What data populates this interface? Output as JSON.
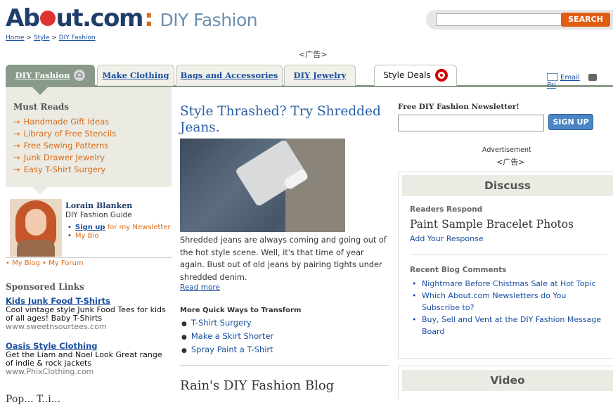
{
  "header": {
    "logo_text": "About.com",
    "site_section": "DIY Fashion",
    "breadcrumb": {
      "home": "Home",
      "sep1": " > ",
      "style": "Style",
      "sep2": " > ",
      "diy": "DIY Fashion"
    },
    "search_button": "SEARCH",
    "ad_label": "<广告>"
  },
  "tabs": [
    {
      "label": "DIY Fashion"
    },
    {
      "label": "Make Clothing"
    },
    {
      "label": "Bags and Accessories"
    },
    {
      "label": "DIY Jewelry"
    },
    {
      "label": "Style Deals"
    }
  ],
  "tools": {
    "email": "Email",
    "print": "Pri"
  },
  "left": {
    "must_reads_title": "Must Reads",
    "must_reads": [
      "Handmade Gift Ideas",
      "Library of Free Stencils",
      "Free Sewing Patterns",
      "Junk Drawer Jewelry",
      "Easy T-Shirt Surgery"
    ],
    "guide": {
      "name": "Lorain Blanken",
      "role": "DIY Fashion Guide",
      "signup_link": "Sign up",
      "signup_rest": " for my Newsletter",
      "bio": "My Bio",
      "blog": "My Blog",
      "forum": "My Forum"
    },
    "sponsored_title": "Sponsored Links",
    "sponsored": [
      {
        "title": "Kids Junk Food T-Shirts",
        "desc": "Cool vintage style Junk Food Tees for kids of all ages! Baby T-Shirts",
        "url": "www.sweetnsourtees.com"
      },
      {
        "title": "Oasis Style Clothing",
        "desc": "Get the Liam and Noel Look Great range of indie & rock jackets",
        "url": "www.PhixClothing.com"
      }
    ],
    "bottom_heading": "Pop... T..i..."
  },
  "main": {
    "article_title": "Style Thrashed? Try Shredded Jeans.",
    "article_text": "Shredded jeans are always coming and going out of the hot style scene. Well, it's that time of year again. Bust out of old jeans by pairing tights under shredded denim.",
    "read_more": "Read more",
    "more_title": "More Quick Ways to Transform",
    "more_links": [
      "T-Shirt Surgery",
      "Make a Skirt Shorter",
      "Spray Paint a T-Shirt"
    ],
    "blog_title": "Rain's DIY Fashion Blog"
  },
  "right": {
    "newsletter_title": "Free DIY Fashion Newsletter!",
    "signup_button": "SIGN UP",
    "advertisement": "Advertisement",
    "ad_label": "<广告>",
    "discuss_title": "Discuss",
    "readers_respond": "Readers Respond",
    "readers_title": "Paint Sample Bracelet Photos",
    "add_response": "Add Your Response",
    "recent_comments_title": "Recent Blog Comments",
    "recent_comments": [
      "Nightmare Before Chistmas Sale at Hot Topic",
      "Which About.com Newsletters do You Subscribe to?",
      "Buy, Sell and Vent at the DIY Fashion Message Board"
    ],
    "video_title": "Video"
  },
  "colors": {
    "brand_blue": "#1f3e6a",
    "accent_orange": "#e05e12",
    "tab_gray": "#8a9a8a",
    "link": "#1a4fa0"
  }
}
